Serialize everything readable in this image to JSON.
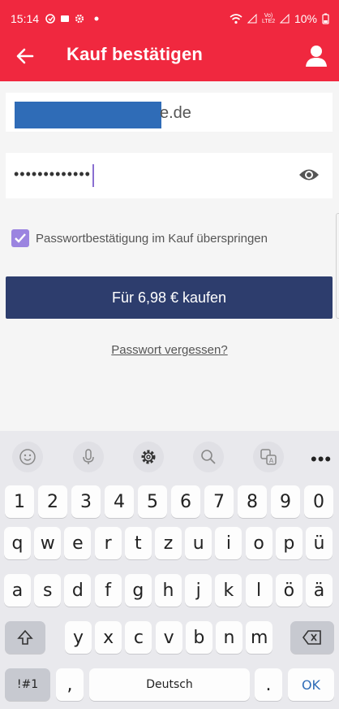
{
  "status_bar": {
    "time": "15:14",
    "battery": "10%",
    "network": "Vo) LTE2"
  },
  "app_bar": {
    "title": "Kauf bestätigen"
  },
  "form": {
    "email_suffix": "e.de",
    "password_mask": "•••••••••••••",
    "skip_checkbox_label": "Passwortbestätigung im Kauf überspringen",
    "skip_checked": true,
    "buy_button_label": "Für 6,98 € kaufen",
    "forgot_link": "Passwort vergessen?"
  },
  "keyboard": {
    "language": "Deutsch",
    "ok_label": "OK",
    "symbols_label": "!#1",
    "comma": ",",
    "period": ".",
    "row_numbers": [
      "1",
      "2",
      "3",
      "4",
      "5",
      "6",
      "7",
      "8",
      "9",
      "0"
    ],
    "row1": [
      "q",
      "w",
      "e",
      "r",
      "t",
      "z",
      "u",
      "i",
      "o",
      "p",
      "ü"
    ],
    "row2": [
      "a",
      "s",
      "d",
      "f",
      "g",
      "h",
      "j",
      "k",
      "l",
      "ö",
      "ä"
    ],
    "row3": [
      "y",
      "x",
      "c",
      "v",
      "b",
      "n",
      "m"
    ]
  },
  "colors": {
    "brand_red": "#f0283f",
    "button_navy": "#2d3d6d",
    "checkbox_purple": "#9b84e0"
  }
}
